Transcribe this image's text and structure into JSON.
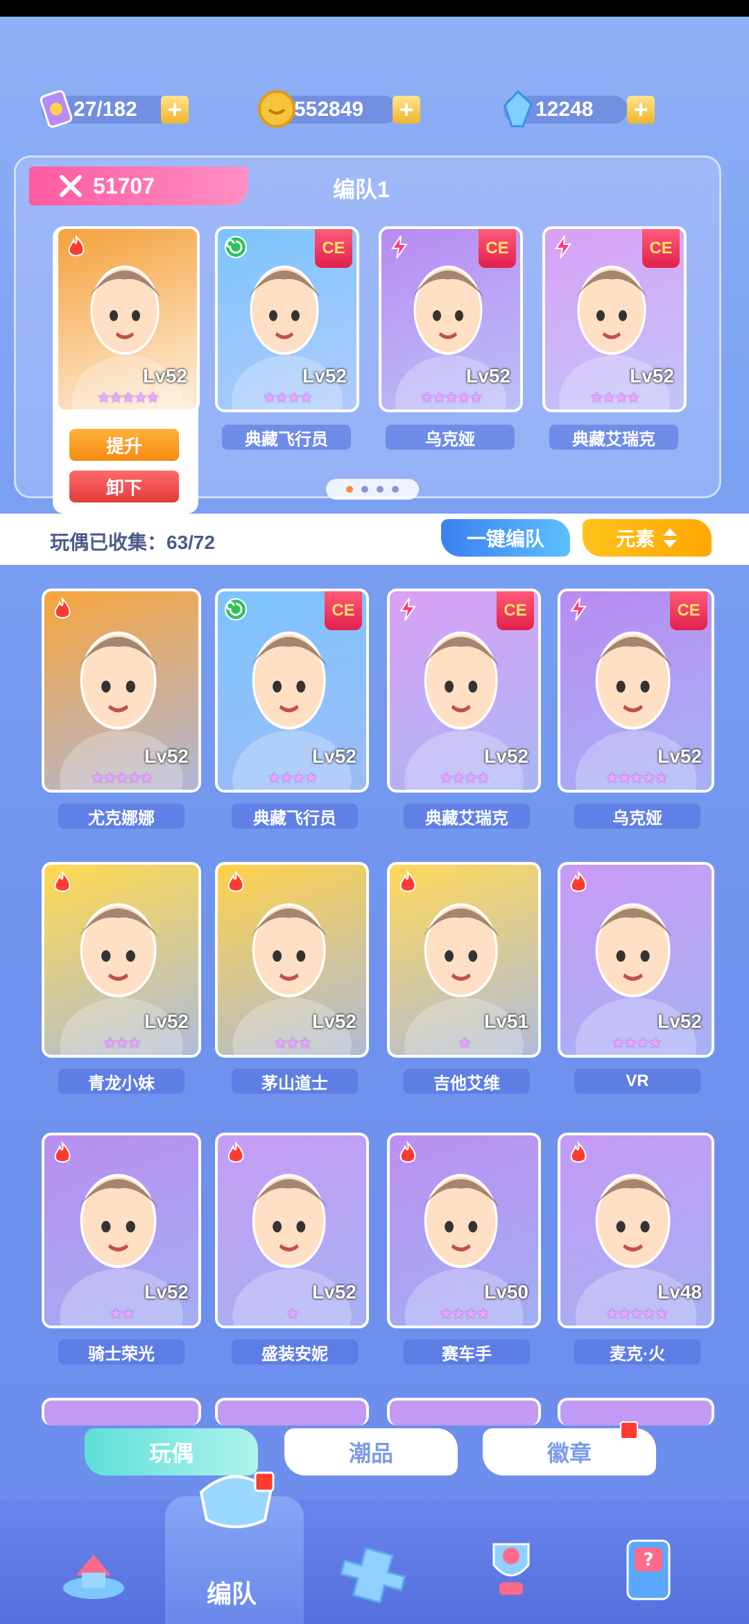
{
  "resources": [
    {
      "icon": "ticket-icon",
      "value": "27/182"
    },
    {
      "icon": "coin-icon",
      "value": "552849"
    },
    {
      "icon": "crystal-icon",
      "value": "12248"
    }
  ],
  "team": {
    "power": "51707",
    "title": "编队1",
    "members": [
      {
        "element": "fire",
        "level": "Lv52",
        "stars": "★★★★★",
        "name": "",
        "ce": false,
        "bg": "#f5a13a"
      },
      {
        "element": "wind",
        "level": "Lv52",
        "stars": "★★★★",
        "name": "典藏飞行员",
        "ce": true,
        "ce_text": "CE",
        "bg": "#7cc4ff"
      },
      {
        "element": "lightning",
        "level": "Lv52",
        "stars": "★★★★★",
        "name": "乌克娅",
        "ce": true,
        "ce_text": "CE",
        "bg": "#b98af2"
      },
      {
        "element": "lightning",
        "level": "Lv52",
        "stars": "★★★★",
        "name": "典藏艾瑞克",
        "ce": true,
        "ce_text": "CE",
        "bg": "#d9a0f5"
      }
    ],
    "upgrade_label": "提升",
    "remove_label": "卸下"
  },
  "collection": {
    "label": "玩偶已收集：63/72",
    "onekey_label": "一键编队",
    "element_label": "元素"
  },
  "dolls": [
    {
      "element": "fire",
      "level": "Lv52",
      "stars": "★★★★★",
      "name": "尤克娜娜",
      "ce": false,
      "bg": "#f7a53c"
    },
    {
      "element": "wind",
      "level": "Lv52",
      "stars": "★★★★",
      "name": "典藏飞行员",
      "ce": true,
      "ce_text": "CE",
      "bg": "#7cc4ff"
    },
    {
      "element": "lightning",
      "level": "Lv52",
      "stars": "★★★★",
      "name": "典藏艾瑞克",
      "ce": true,
      "ce_text": "CE",
      "bg": "#d9a0f5"
    },
    {
      "element": "lightning",
      "level": "Lv52",
      "stars": "★★★★★",
      "name": "乌克娅",
      "ce": true,
      "ce_text": "CE",
      "bg": "#b98af2"
    },
    {
      "element": "fire",
      "level": "Lv52",
      "stars": "★★★",
      "name": "青龙小妹",
      "ce": false,
      "bg": "#ffd94f"
    },
    {
      "element": "fire",
      "level": "Lv52",
      "stars": "★★★",
      "name": "茅山道士",
      "ce": false,
      "bg": "#ffd14a"
    },
    {
      "element": "fire",
      "level": "Lv51",
      "stars": "★",
      "name": "吉他艾维",
      "ce": false,
      "bg": "#ffd85a"
    },
    {
      "element": "fire",
      "level": "Lv52",
      "stars": "★★★★",
      "name": "VR",
      "ce": false,
      "bg": "#c99af5"
    },
    {
      "element": "fire",
      "level": "Lv52",
      "stars": "★★",
      "name": "骑士荣光",
      "ce": false,
      "bg": "#b98ef0"
    },
    {
      "element": "fire",
      "level": "Lv52",
      "stars": "★",
      "name": "盛装安妮",
      "ce": false,
      "bg": "#c79cf4"
    },
    {
      "element": "fire",
      "level": "Lv50",
      "stars": "★★★★",
      "name": "赛车手",
      "ce": false,
      "bg": "#bb90f2"
    },
    {
      "element": "fire",
      "level": "Lv48",
      "stars": "★★★★★",
      "name": "麦克·火",
      "ce": false,
      "bg": "#c59af4"
    }
  ],
  "tabs": [
    {
      "label": "玩偶",
      "active": true
    },
    {
      "label": "潮品",
      "active": false
    },
    {
      "label": "徽章",
      "active": false
    }
  ],
  "nav": [
    {
      "icon": "home-icon",
      "label": ""
    },
    {
      "icon": "team-icon",
      "label": "编队"
    },
    {
      "icon": "gamepad-icon",
      "label": ""
    },
    {
      "icon": "trophy-icon",
      "label": ""
    },
    {
      "icon": "gacha-machine-icon",
      "label": ""
    }
  ]
}
